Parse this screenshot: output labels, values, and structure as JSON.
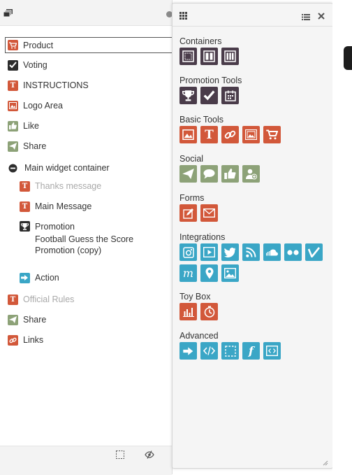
{
  "layers": {
    "items": [
      {
        "label": "Product",
        "icon": "cart-icon",
        "color": "#d2583a",
        "state": "selected"
      },
      {
        "label": "Voting",
        "icon": "check-icon",
        "color": "#2d2d2d",
        "state": "normal"
      },
      {
        "label": "INSTRUCTIONS",
        "icon": "text-icon",
        "color": "#d2583a",
        "state": "normal"
      },
      {
        "label": "Logo Area",
        "icon": "image-icon",
        "color": "#d2583a",
        "state": "normal"
      },
      {
        "label": "Like",
        "icon": "thumbs-up-icon",
        "color": "#8da278",
        "state": "normal"
      },
      {
        "label": "Share",
        "icon": "paper-plane-icon",
        "color": "#8da278",
        "state": "normal"
      },
      {
        "label": "Main widget container",
        "icon": "minus-circle-icon",
        "color": "#2d2d2d",
        "state": "expanded"
      },
      {
        "label": "Thanks message",
        "icon": "text-icon",
        "color": "#d2583a",
        "state": "hidden"
      },
      {
        "label": "Main Message",
        "icon": "text-icon",
        "color": "#d2583a",
        "state": "normal"
      },
      {
        "label": "Promotion",
        "sub": "Football Guess the Score Promotion (copy)",
        "icon": "trophy-icon",
        "color": "#2d2d2d",
        "state": "normal"
      },
      {
        "label": "Action",
        "icon": "arrow-icon",
        "color": "#3aa6c6",
        "state": "normal"
      },
      {
        "label": "Official Rules",
        "icon": "text-icon",
        "color": "#d2583a",
        "state": "hidden"
      },
      {
        "label": "Share",
        "icon": "paper-plane-icon",
        "color": "#8da278",
        "state": "normal"
      },
      {
        "label": "Links",
        "icon": "link-icon",
        "color": "#d2583a",
        "state": "normal"
      }
    ]
  },
  "widgets": {
    "sections": [
      {
        "title": "Containers",
        "tiles": [
          "grid-container-icon",
          "two-column-icon",
          "three-column-icon"
        ]
      },
      {
        "title": "Promotion Tools",
        "tiles": [
          "trophy-icon",
          "check-icon",
          "calendar-icon"
        ]
      },
      {
        "title": "Basic Tools",
        "tiles": [
          "image-icon",
          "text-icon",
          "link-icon",
          "slideshow-icon",
          "cart-icon"
        ]
      },
      {
        "title": "Social",
        "tiles": [
          "paper-plane-icon",
          "speech-bubble-icon",
          "thumbs-up-icon",
          "add-user-icon"
        ]
      },
      {
        "title": "Forms",
        "tiles": [
          "edit-form-icon",
          "envelope-icon"
        ]
      },
      {
        "title": "Integrations",
        "tiles": [
          "instagram-icon",
          "video-play-icon",
          "twitter-icon",
          "rss-icon",
          "soundcloud-icon",
          "flickr-icon",
          "vine-icon",
          "mailchimp-icon",
          "map-pin-icon",
          "picture-icon"
        ]
      },
      {
        "title": "Toy Box",
        "tiles": [
          "bar-chart-icon",
          "timer-icon"
        ]
      },
      {
        "title": "Advanced",
        "tiles": [
          "arrow-icon",
          "code-icon",
          "selection-box-icon",
          "function-icon",
          "embed-icon"
        ]
      }
    ]
  },
  "colors": {
    "dark": "#4a3c4a",
    "red": "#d2583a",
    "sage": "#8da278",
    "teal": "#3aa6c6"
  }
}
